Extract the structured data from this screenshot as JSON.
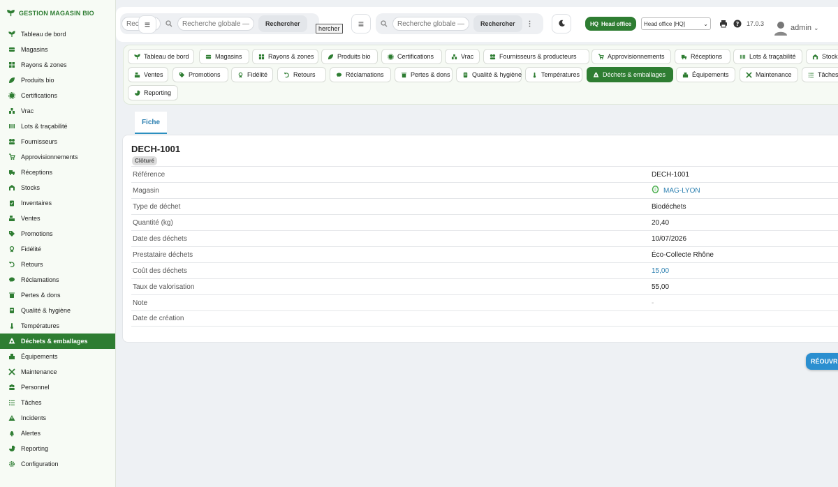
{
  "brand": {
    "name": "GESTION MAGASIN BIO"
  },
  "sidebar": {
    "items": [
      {
        "label": "Tableau de bord",
        "icon": "seedling-icon"
      },
      {
        "label": "Magasins",
        "icon": "store-icon"
      },
      {
        "label": "Rayons & zones",
        "icon": "grid-icon"
      },
      {
        "label": "Produits bio",
        "icon": "leaf-icon"
      },
      {
        "label": "Certifications",
        "icon": "certificate-icon"
      },
      {
        "label": "Vrac",
        "icon": "bulk-icon"
      },
      {
        "label": "Lots & traçabilité",
        "icon": "barcode-icon"
      },
      {
        "label": "Fournisseurs",
        "icon": "supplier-icon"
      },
      {
        "label": "Approvisionnements",
        "icon": "cart-icon"
      },
      {
        "label": "Réceptions",
        "icon": "truck-icon"
      },
      {
        "label": "Stocks",
        "icon": "warehouse-icon"
      },
      {
        "label": "Inventaires",
        "icon": "clipboard-icon"
      },
      {
        "label": "Ventes",
        "icon": "cash-register-icon"
      },
      {
        "label": "Promotions",
        "icon": "tag-icon"
      },
      {
        "label": "Fidélité",
        "icon": "award-icon"
      },
      {
        "label": "Retours",
        "icon": "undo-icon"
      },
      {
        "label": "Réclamations",
        "icon": "comment-icon"
      },
      {
        "label": "Pertes & dons",
        "icon": "trash-icon"
      },
      {
        "label": "Qualité & hygiène",
        "icon": "quality-icon"
      },
      {
        "label": "Températures",
        "icon": "thermometer-icon"
      },
      {
        "label": "Déchets & emballages",
        "icon": "recycle-icon",
        "active": true
      },
      {
        "label": "Équipements",
        "icon": "equipment-icon"
      },
      {
        "label": "Maintenance",
        "icon": "tools-icon"
      },
      {
        "label": "Personnel",
        "icon": "users-icon"
      },
      {
        "label": "Tâches",
        "icon": "tasks-icon"
      },
      {
        "label": "Incidents",
        "icon": "warning-icon"
      },
      {
        "label": "Alertes",
        "icon": "bell-icon"
      },
      {
        "label": "Reporting",
        "icon": "chart-pie-icon"
      },
      {
        "label": "Configuration",
        "icon": "gear-icon"
      }
    ]
  },
  "topbar": {
    "search_placeholder": "Recherche globale — cl",
    "search_button": "Rechercher",
    "search_fragment": "Rech",
    "search_fragment_suffix": "g",
    "ghost_button": "hercher",
    "hq_badge": "HQ Head office",
    "hq_short": "HQ",
    "hq_name": "Head office",
    "hq_select": "Head office [HQ]",
    "version": "17.0.3",
    "user": "admin"
  },
  "module_tabs": {
    "row1": [
      "Tableau de bord",
      "Magasins",
      "Rayons & zones",
      "Produits bio",
      "Certifications",
      "Vrac",
      "Fournisseurs & producteurs",
      "Approvisionnements",
      "Réceptions",
      "Lots & traçabilité",
      "Stock"
    ],
    "row2": [
      "Ventes",
      "Promotions",
      "Fidélité",
      "Retours",
      "Réclamations",
      "Pertes & dons",
      "Qualité & hygiène",
      "Températures",
      "Déchets & emballages",
      "Équipements",
      "Maintenance",
      "Tâches"
    ],
    "row3": [
      "Reporting"
    ],
    "active": "Déchets & emballages"
  },
  "record": {
    "tab": "Fiche",
    "title": "DECH-1001",
    "status": "Clôturé",
    "fields": [
      {
        "label": "Référence",
        "value": "DECH-1001"
      },
      {
        "label": "Magasin",
        "value": "MAG-LYON",
        "link": true
      },
      {
        "label": "Type de déchet",
        "value": "Biodéchets"
      },
      {
        "label": "Quantité (kg)",
        "value": "20,40"
      },
      {
        "label": "Date des déchets",
        "value": "10/07/2026"
      },
      {
        "label": "Prestataire déchets",
        "value": "Éco-Collecte Rhône"
      },
      {
        "label": "Coût des déchets",
        "value": "15,00",
        "link": true
      },
      {
        "label": "Taux de valorisation",
        "value": "55,00"
      },
      {
        "label": "Note",
        "value": "-",
        "muted": true
      },
      {
        "label": "Date de création",
        "value": ""
      }
    ],
    "reopen_button": "RÉOUVR"
  },
  "colors": {
    "primary": "#2e7d32",
    "link": "#2b7fb0",
    "accent_button": "#2b8fd0"
  }
}
